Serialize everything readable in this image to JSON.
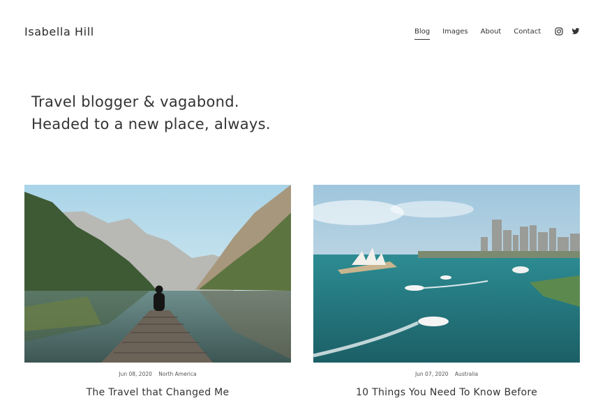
{
  "site": {
    "title": "Isabella Hill"
  },
  "nav": {
    "items": [
      {
        "label": "Blog",
        "active": true
      },
      {
        "label": "Images",
        "active": false
      },
      {
        "label": "About",
        "active": false
      },
      {
        "label": "Contact",
        "active": false
      }
    ],
    "social": [
      "instagram-icon",
      "twitter-icon"
    ]
  },
  "hero": {
    "line1": "Travel blogger & vagabond.",
    "line2": "Headed to a new place, always."
  },
  "posts": [
    {
      "date": "Jun 08, 2020",
      "category": "North America",
      "title": "The Travel that Changed Me"
    },
    {
      "date": "Jun 07, 2020",
      "category": "Australia",
      "title": "10 Things You Need To Know Before"
    }
  ]
}
